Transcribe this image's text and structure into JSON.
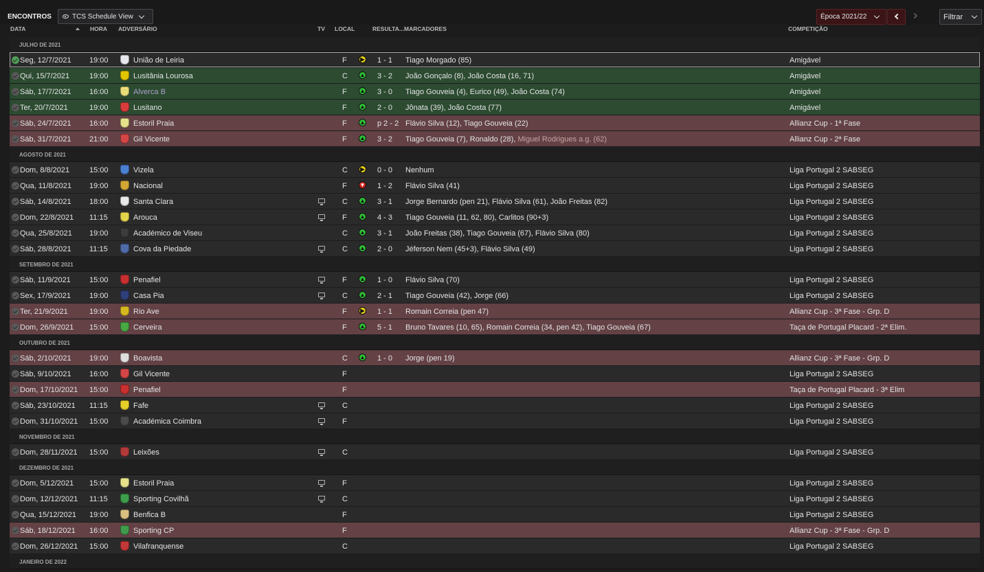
{
  "header": {
    "title": "ENCONTROS",
    "view_label": "TCS Schedule View",
    "season_label": "Época 2021/22",
    "filter_label": "Filtrar"
  },
  "columns": {
    "data": "DATA",
    "hora": "HORA",
    "adversario": "ADVERSÁRIO",
    "tv": "TV",
    "local": "LOCAL",
    "resultado": "RESULTA...",
    "marcadores": "MARCADORES",
    "competicao": "COMPETIÇÃO"
  },
  "colors": {
    "win": "#2c4b31",
    "cup": "#634145",
    "std": "#2a2a2b"
  },
  "groups": [
    {
      "month": "JULHO DE 2021",
      "matches": [
        {
          "date": "Seg, 12/7/2021",
          "time": "19:00",
          "opp": "União de Leiria",
          "crest": "#e7e7ef",
          "tv": false,
          "venue": "F",
          "res": "D",
          "res_icon": "play-icon",
          "score": "1 - 1",
          "scorers": "Tiago Morgado (85)",
          "og": "",
          "comp": "Amigável",
          "bg": "std",
          "done": true,
          "selected": true
        },
        {
          "date": "Qui, 15/7/2021",
          "time": "19:00",
          "opp": "Lusitânia Lourosa",
          "crest": "#e2c400",
          "tv": false,
          "venue": "C",
          "res": "W",
          "res_icon": "up-arrow-icon",
          "score": "3 - 2",
          "scorers": "João Gonçalo (8), João Costa (16, 71)",
          "og": "",
          "comp": "Amigável",
          "bg": "win",
          "done": false,
          "selected": false
        },
        {
          "date": "Sáb, 17/7/2021",
          "time": "16:00",
          "opp": "Alverca B",
          "crest": "#e9dc7a",
          "tv": false,
          "venue": "F",
          "res": "W",
          "res_icon": "up-arrow-icon",
          "score": "3 - 0",
          "scorers": "Tiago Gouveia (4), Eurico (49), João Costa (74)",
          "og": "",
          "comp": "Amigável",
          "bg": "win",
          "done": false,
          "selected": false,
          "inactive": true
        },
        {
          "date": "Ter, 20/7/2021",
          "time": "19:00",
          "opp": "Lusitano",
          "crest": "#d93c3c",
          "tv": false,
          "venue": "F",
          "res": "W",
          "res_icon": "up-arrow-icon",
          "score": "2 - 0",
          "scorers": "Jônata (39), João Costa (77)",
          "og": "",
          "comp": "Amigável",
          "bg": "win",
          "done": false,
          "selected": false
        },
        {
          "date": "Sáb, 24/7/2021",
          "time": "16:00",
          "opp": "Estoril Praia",
          "crest": "#e6e28a",
          "tv": false,
          "venue": "F",
          "res": "W",
          "res_icon": "up-arrow-icon",
          "score": "p 2 - 2",
          "scorers": "Flávio Silva (12), Tiago Gouveia (22)",
          "og": "",
          "comp": "Allianz Cup - 1ª Fase",
          "bg": "cup",
          "done": false,
          "selected": false
        },
        {
          "date": "Sáb, 31/7/2021",
          "time": "21:00",
          "opp": "Gil Vicente",
          "crest": "#d24646",
          "tv": false,
          "venue": "F",
          "res": "W",
          "res_icon": "up-arrow-icon",
          "score": "3 - 2",
          "scorers": "Tiago Gouveia (7), Ronaldo (28),",
          "og": "Miguel Rodrigues a.g. (62)",
          "comp": "Allianz Cup - 2ª Fase",
          "bg": "cup",
          "done": false,
          "selected": false
        }
      ]
    },
    {
      "month": "AGOSTO DE 2021",
      "matches": [
        {
          "date": "Dom, 8/8/2021",
          "time": "15:00",
          "opp": "Vizela",
          "crest": "#4b7fd1",
          "tv": false,
          "venue": "C",
          "res": "D",
          "res_icon": "play-icon",
          "score": "0 - 0",
          "scorers": "Nenhum",
          "og": "",
          "comp": "Liga Portugal 2 SABSEG",
          "bg": "std",
          "done": false,
          "selected": false
        },
        {
          "date": "Qua, 11/8/2021",
          "time": "19:00",
          "opp": "Nacional",
          "crest": "#d2a733",
          "tv": false,
          "venue": "F",
          "res": "L",
          "res_icon": "down-arrow-icon",
          "score": "1 - 2",
          "scorers": "Flávio Silva (41)",
          "og": "",
          "comp": "Liga Portugal 2 SABSEG",
          "bg": "std",
          "done": false,
          "selected": false
        },
        {
          "date": "Sáb, 14/8/2021",
          "time": "18:00",
          "opp": "Santa Clara",
          "crest": "#e9e9e9",
          "tv": true,
          "venue": "C",
          "res": "W",
          "res_icon": "up-arrow-icon",
          "score": "3 - 1",
          "scorers": "Jorge Bernardo (pen 21), Flávio Silva (61), João Freitas (82)",
          "og": "",
          "comp": "Liga Portugal 2 SABSEG",
          "bg": "std",
          "done": false,
          "selected": false
        },
        {
          "date": "Dom, 22/8/2021",
          "time": "11:15",
          "opp": "Arouca",
          "crest": "#e3d34a",
          "tv": true,
          "venue": "F",
          "res": "W",
          "res_icon": "up-arrow-icon",
          "score": "4 - 3",
          "scorers": "Tiago Gouveia (11, 62, 80), Carlitos (90+3)",
          "og": "",
          "comp": "Liga Portugal 2 SABSEG",
          "bg": "std",
          "done": false,
          "selected": false
        },
        {
          "date": "Qua, 25/8/2021",
          "time": "19:00",
          "opp": "Académico de Viseu",
          "crest": "#3c3c3c",
          "tv": false,
          "venue": "C",
          "res": "W",
          "res_icon": "up-arrow-icon",
          "score": "3 - 1",
          "scorers": "João Freitas (38), Tiago Gouveia (67), Flávio Silva (80)",
          "og": "",
          "comp": "Liga Portugal 2 SABSEG",
          "bg": "std",
          "done": false,
          "selected": false
        },
        {
          "date": "Sáb, 28/8/2021",
          "time": "11:15",
          "opp": "Cova da Piedade",
          "crest": "#4f6aa8",
          "tv": true,
          "venue": "C",
          "res": "W",
          "res_icon": "up-arrow-icon",
          "score": "2 - 0",
          "scorers": "Jéferson Nem (45+3), Flávio Silva (49)",
          "og": "",
          "comp": "Liga Portugal 2 SABSEG",
          "bg": "std",
          "done": false,
          "selected": false
        }
      ]
    },
    {
      "month": "SETEMBRO DE 2021",
      "matches": [
        {
          "date": "Sáb, 11/9/2021",
          "time": "15:00",
          "opp": "Penafiel",
          "crest": "#c82f2f",
          "tv": true,
          "venue": "F",
          "res": "W",
          "res_icon": "up-arrow-icon",
          "score": "1 - 0",
          "scorers": "Flávio Silva (70)",
          "og": "",
          "comp": "Liga Portugal 2 SABSEG",
          "bg": "std",
          "done": false,
          "selected": false
        },
        {
          "date": "Sex, 17/9/2021",
          "time": "19:00",
          "opp": "Casa Pia",
          "crest": "#2f3f7a",
          "tv": true,
          "venue": "C",
          "res": "W",
          "res_icon": "up-arrow-icon",
          "score": "2 - 1",
          "scorers": "Tiago Gouveia (42), Jorge (66)",
          "og": "",
          "comp": "Liga Portugal 2 SABSEG",
          "bg": "std",
          "done": false,
          "selected": false
        },
        {
          "date": "Ter, 21/9/2021",
          "time": "19:00",
          "opp": "Rio Ave",
          "crest": "#d6b821",
          "tv": false,
          "venue": "F",
          "res": "D",
          "res_icon": "play-icon",
          "score": "1 - 1",
          "scorers": "Romain Correia (pen 47)",
          "og": "",
          "comp": "Allianz Cup - 3ª Fase - Grp. D",
          "bg": "cup",
          "done": false,
          "selected": false
        },
        {
          "date": "Dom, 26/9/2021",
          "time": "15:00",
          "opp": "Cerveira",
          "crest": "#47a942",
          "tv": false,
          "venue": "F",
          "res": "W",
          "res_icon": "up-arrow-icon",
          "score": "5 - 1",
          "scorers": "Bruno Tavares (10, 65), Romain Correia (34, pen 42), Tiago Gouveia (67)",
          "og": "",
          "comp": "Taça de Portugal Placard - 2ª Elim.",
          "bg": "cup",
          "done": false,
          "selected": false
        }
      ]
    },
    {
      "month": "OUTUBRO DE 2021",
      "matches": [
        {
          "date": "Sáb, 2/10/2021",
          "time": "19:00",
          "opp": "Boavista",
          "crest": "#dedede",
          "tv": false,
          "venue": "C",
          "res": "W",
          "res_icon": "up-arrow-icon",
          "score": "1 - 0",
          "scorers": "Jorge (pen 19)",
          "og": "",
          "comp": "Allianz Cup - 3ª Fase - Grp. D",
          "bg": "cup",
          "done": false,
          "selected": false
        },
        {
          "date": "Sáb, 9/10/2021",
          "time": "16:00",
          "opp": "Gil Vicente",
          "crest": "#d24646",
          "tv": false,
          "venue": "F",
          "res": "",
          "res_icon": "",
          "score": "",
          "scorers": "",
          "og": "",
          "comp": "Liga Portugal 2 SABSEG",
          "bg": "std",
          "done": false,
          "selected": false
        },
        {
          "date": "Dom, 17/10/2021",
          "time": "15:00",
          "opp": "Penafiel",
          "crest": "#c82f2f",
          "tv": false,
          "venue": "F",
          "res": "",
          "res_icon": "",
          "score": "",
          "scorers": "",
          "og": "",
          "comp": "Taça de Portugal Placard - 3ª Elim",
          "bg": "cup",
          "done": false,
          "selected": false
        },
        {
          "date": "Sáb, 23/10/2021",
          "time": "11:15",
          "opp": "Fafe",
          "crest": "#e7cf2a",
          "tv": true,
          "venue": "C",
          "res": "",
          "res_icon": "",
          "score": "",
          "scorers": "",
          "og": "",
          "comp": "Liga Portugal 2 SABSEG",
          "bg": "std",
          "done": false,
          "selected": false
        },
        {
          "date": "Dom, 31/10/2021",
          "time": "15:00",
          "opp": "Académica Coimbra",
          "crest": "#4a4a4a",
          "tv": true,
          "venue": "F",
          "res": "",
          "res_icon": "",
          "score": "",
          "scorers": "",
          "og": "",
          "comp": "Liga Portugal 2 SABSEG",
          "bg": "std",
          "done": false,
          "selected": false
        }
      ]
    },
    {
      "month": "NOVEMBRO DE 2021",
      "matches": [
        {
          "date": "Dom, 28/11/2021",
          "time": "15:00",
          "opp": "Leixões",
          "crest": "#b13a3a",
          "tv": true,
          "venue": "C",
          "res": "",
          "res_icon": "",
          "score": "",
          "scorers": "",
          "og": "",
          "comp": "Liga Portugal 2 SABSEG",
          "bg": "std",
          "done": false,
          "selected": false
        }
      ]
    },
    {
      "month": "DEZEMBRO DE 2021",
      "matches": [
        {
          "date": "Dom, 5/12/2021",
          "time": "15:00",
          "opp": "Estoril Praia",
          "crest": "#e6e28a",
          "tv": true,
          "venue": "F",
          "res": "",
          "res_icon": "",
          "score": "",
          "scorers": "",
          "og": "",
          "comp": "Liga Portugal 2 SABSEG",
          "bg": "std",
          "done": false,
          "selected": false
        },
        {
          "date": "Dom, 12/12/2021",
          "time": "11:15",
          "opp": "Sporting Covilhã",
          "crest": "#3c9d4a",
          "tv": true,
          "venue": "C",
          "res": "",
          "res_icon": "",
          "score": "",
          "scorers": "",
          "og": "",
          "comp": "Liga Portugal 2 SABSEG",
          "bg": "std",
          "done": false,
          "selected": false
        },
        {
          "date": "Qua, 15/12/2021",
          "time": "19:00",
          "opp": "Benfica B",
          "crest": "#d8c080",
          "tv": false,
          "venue": "F",
          "res": "",
          "res_icon": "",
          "score": "",
          "scorers": "",
          "og": "",
          "comp": "Liga Portugal 2 SABSEG",
          "bg": "std",
          "done": false,
          "selected": false
        },
        {
          "date": "Sáb, 18/12/2021",
          "time": "16:00",
          "opp": "Sporting CP",
          "crest": "#3f9b4b",
          "tv": false,
          "venue": "F",
          "res": "",
          "res_icon": "",
          "score": "",
          "scorers": "",
          "og": "",
          "comp": "Allianz Cup - 3ª Fase - Grp. D",
          "bg": "cup",
          "done": false,
          "selected": false
        },
        {
          "date": "Dom, 26/12/2021",
          "time": "15:00",
          "opp": "Vilafranquense",
          "crest": "#c33838",
          "tv": false,
          "venue": "C",
          "res": "",
          "res_icon": "",
          "score": "",
          "scorers": "",
          "og": "",
          "comp": "Liga Portugal 2 SABSEG",
          "bg": "std",
          "done": false,
          "selected": false
        }
      ]
    },
    {
      "month": "JANEIRO DE 2022",
      "matches": []
    }
  ]
}
